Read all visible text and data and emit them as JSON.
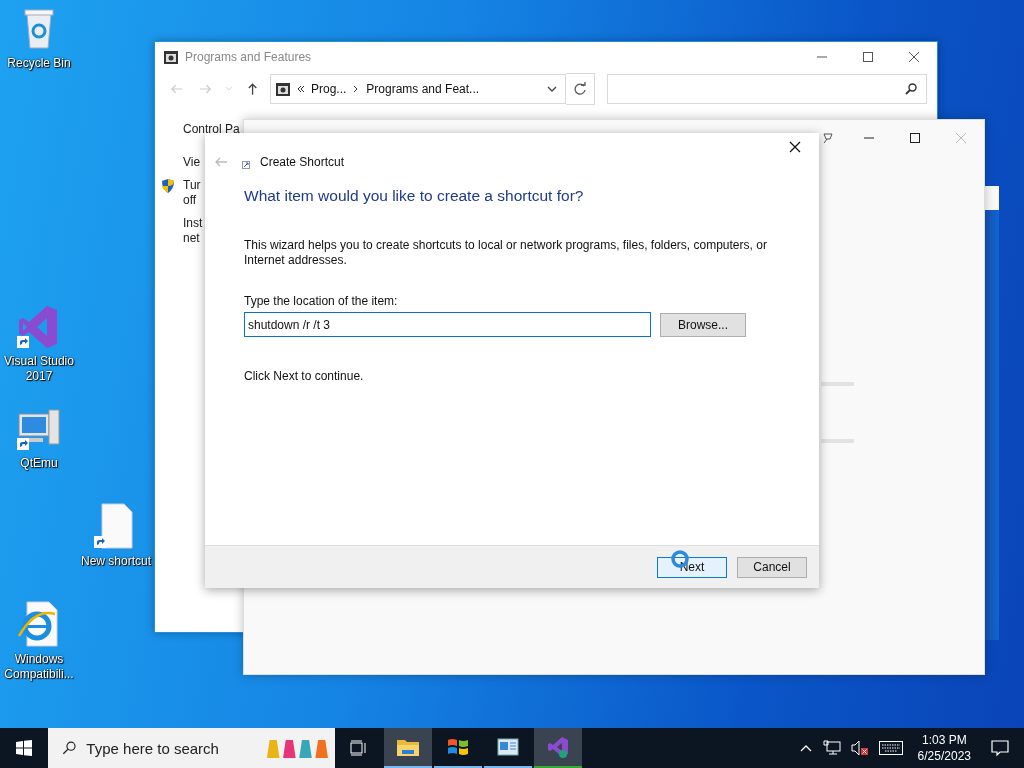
{
  "desktop_icons": [
    {
      "kind": "bin",
      "label": "Recycle Bin",
      "shortcut": false
    },
    {
      "kind": "vs",
      "label": "Visual Studio 2017",
      "shortcut": true
    },
    {
      "kind": "computer",
      "label": "QtEmu",
      "shortcut": true
    },
    {
      "kind": "file",
      "label": "New shortcut",
      "shortcut": true
    },
    {
      "kind": "ie",
      "label": "Windows Compatibili...",
      "shortcut": false
    }
  ],
  "programs_window": {
    "title": "Programs and Features",
    "address": {
      "parent": "Prog...",
      "current": "Programs and Feat..."
    },
    "sidebar": [
      {
        "lines": [
          "Control Pa"
        ],
        "shield": false
      },
      {
        "lines": [
          "Vie"
        ],
        "shield": false
      },
      {
        "lines": [
          "Tur",
          "off"
        ],
        "shield": true
      },
      {
        "lines": [
          "Inst",
          "net"
        ],
        "shield": false
      }
    ]
  },
  "wizard": {
    "title": "Create Shortcut",
    "heading": "What item would you like to create a shortcut for?",
    "description": "This wizard helps you to create shortcuts to local or network programs, files, folders, computers, or Internet addresses.",
    "location_label": "Type the location of the item:",
    "location_value": "shutdown /r /t 3",
    "browse": "Browse...",
    "hint": "Click Next to continue.",
    "buttons": [
      {
        "label": "Next",
        "default": true
      },
      {
        "label": "Cancel",
        "default": false
      }
    ]
  },
  "taskbar": {
    "search": {
      "placeholder": "Type here to search"
    },
    "apps": [
      {
        "kind": "explorer",
        "highlighted": true
      },
      {
        "kind": "windows",
        "highlighted": false
      },
      {
        "kind": "control",
        "highlighted": false
      },
      {
        "kind": "vs",
        "highlighted": true
      }
    ],
    "clock": {
      "time": "1:03 PM",
      "date": "6/25/2023"
    }
  }
}
